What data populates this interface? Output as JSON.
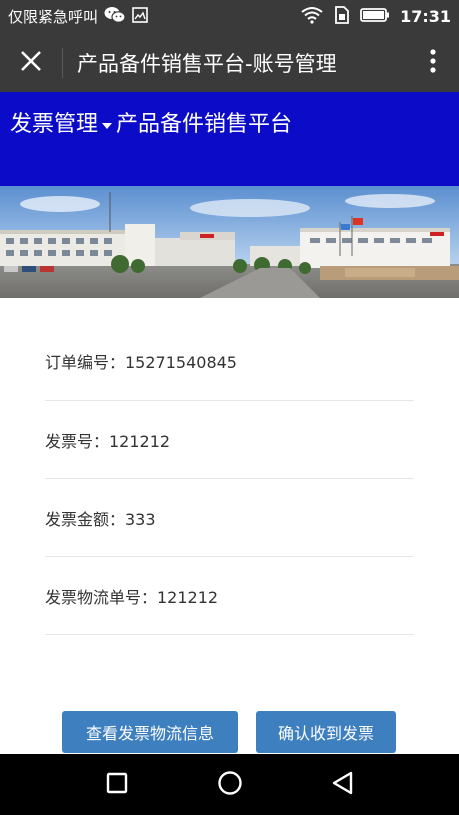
{
  "status_bar": {
    "carrier_text": "仅限紧急呼叫",
    "time": "17:31"
  },
  "title_bar": {
    "title": "产品备件销售平台-账号管理"
  },
  "header": {
    "section": "发票管理",
    "platform": "产品备件销售平台"
  },
  "info": {
    "order_number": "订单编号：15271540845",
    "invoice_number": "发票号：121212",
    "invoice_amount": "发票金额：333",
    "logistics_number": "发票物流单号：121212"
  },
  "actions": {
    "view_logistics": "查看发票物流信息",
    "confirm_receipt": "确认收到发票"
  },
  "colors": {
    "header_bg": "#0b0bc8",
    "button_bg": "#3d7fbf",
    "bar_bg": "#3a3a3a"
  }
}
